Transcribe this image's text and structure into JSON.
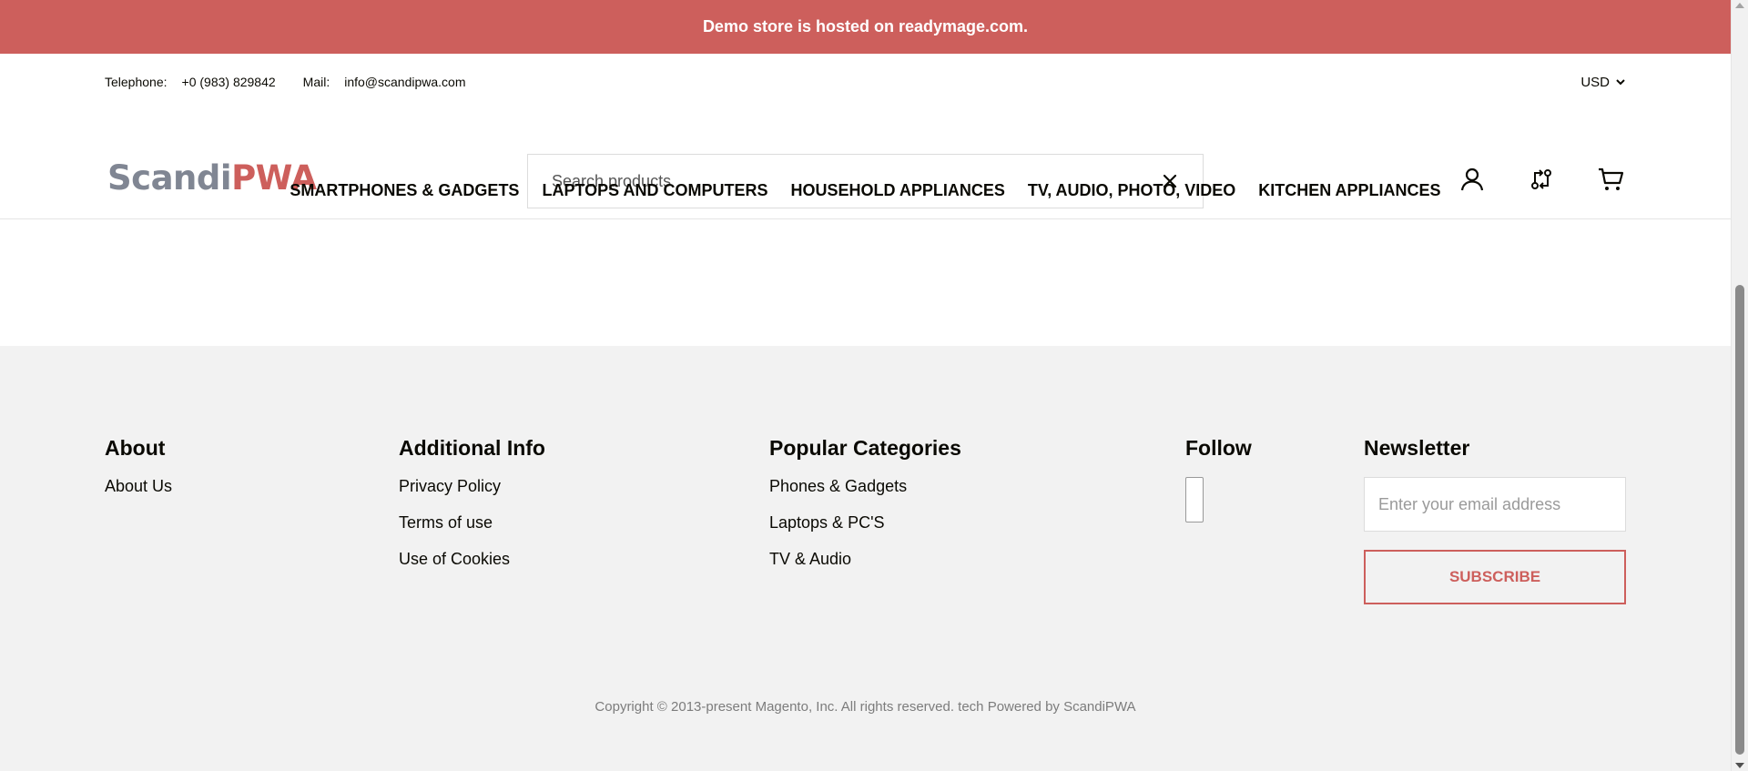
{
  "banner": {
    "text": "Demo store is hosted on readymage.com."
  },
  "header": {
    "telephone_label": "Telephone:",
    "telephone": "+0 (983) 829842",
    "mail_label": "Mail:",
    "mail": "info@scandipwa.com",
    "currency": "USD",
    "logo": {
      "part1": "Scandi",
      "part2": "PWA"
    },
    "search": {
      "placeholder": "Search products",
      "value": ""
    },
    "icons": [
      "account-icon",
      "compare-icon",
      "cart-icon"
    ]
  },
  "menu": {
    "items": [
      "Smartphones & Gadgets",
      "Laptops and Computers",
      "Household Appliances",
      "TV, Audio, Photo, Video",
      "Kitchen Appliances"
    ]
  },
  "footer": {
    "about": {
      "title": "About",
      "links": [
        "About Us"
      ]
    },
    "additional": {
      "title": "Additional Info",
      "links": [
        "Privacy Policy",
        "Terms of use",
        "Use of Cookies"
      ]
    },
    "categories": {
      "title": "Popular Categories",
      "links": [
        "Phones & Gadgets",
        "Laptops & PC'S",
        "TV & Audio"
      ]
    },
    "follow": {
      "title": "Follow"
    },
    "newsletter": {
      "title": "Newsletter",
      "email_placeholder": "Enter your email address",
      "subscribe_label": "Subscribe"
    },
    "copyright": "Copyright © 2013-present Magento, Inc. All rights reserved. tech Powered by ScandiPWA"
  },
  "colors": {
    "accent": "#cd5f5c",
    "logo_gray": "#808693",
    "footer_bg": "#f2f2f2"
  }
}
